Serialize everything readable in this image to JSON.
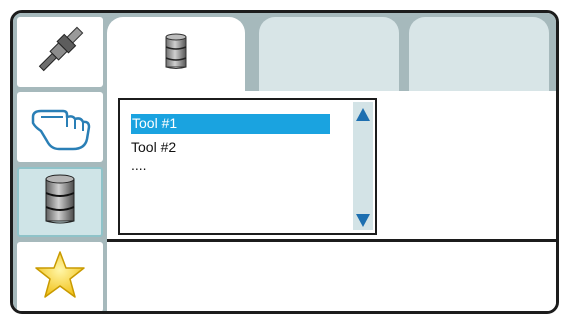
{
  "sidebar": {
    "items": [
      {
        "icon": "tool-icon",
        "selected": false
      },
      {
        "icon": "hand-pointer-icon",
        "selected": false
      },
      {
        "icon": "database-icon",
        "selected": true
      },
      {
        "icon": "star-icon",
        "selected": false
      }
    ]
  },
  "tabs": [
    {
      "icon": "database-icon",
      "active": true
    },
    {
      "active": false
    },
    {
      "active": false
    }
  ],
  "tool_list": {
    "items": [
      "Tool #1",
      "Tool #2",
      "...."
    ],
    "selected_index": 0
  },
  "colors": {
    "frame_bg": "#a6b9bc",
    "selection": "#1aa3e0",
    "scroll_arrow": "#1d6fb0"
  }
}
